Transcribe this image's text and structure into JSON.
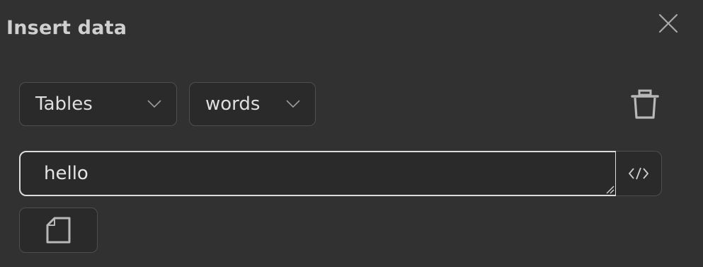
{
  "dialog": {
    "title": "Insert data",
    "close_icon": "close-icon"
  },
  "controls": {
    "source_select": {
      "value": "Tables",
      "icon": "chevron-down-icon"
    },
    "table_select": {
      "value": "words",
      "icon": "chevron-down-icon"
    },
    "delete_icon": "trash-icon"
  },
  "query": {
    "value": "hello",
    "code_icon": "code-icon"
  },
  "actions": {
    "file_icon": "file-icon"
  },
  "colors": {
    "background": "#313131",
    "field_background": "#2a2a2a",
    "border": "#4e4e4e",
    "focus_border": "#dcdcdc",
    "text": "#e4e4e4",
    "icon": "#b8b8b8"
  }
}
